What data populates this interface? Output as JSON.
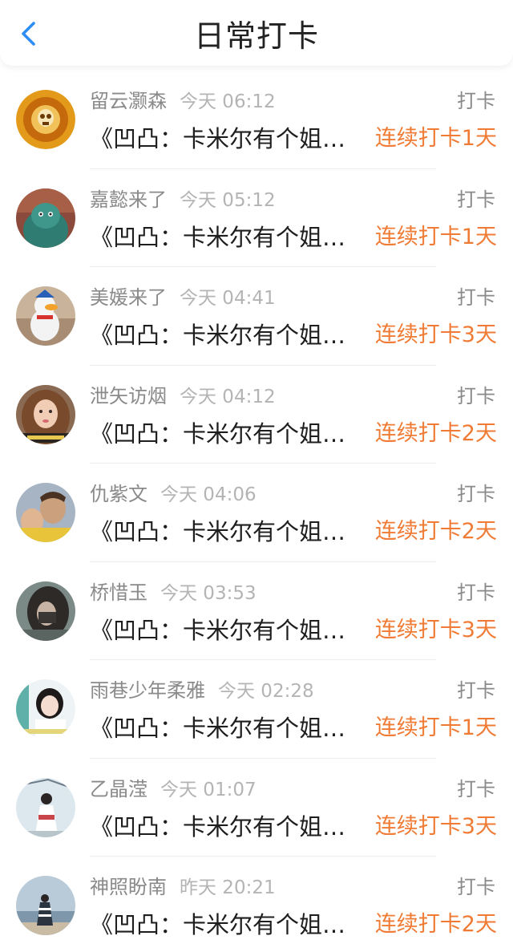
{
  "header": {
    "title": "日常打卡",
    "back_icon": "chevron-left-icon",
    "accent_color": "#2f8ef6"
  },
  "colors": {
    "streak": "#f07b34",
    "name": "#8a8a8a",
    "time": "#b4b4b4"
  },
  "entries": [
    {
      "name": "留云灏森",
      "time": "今天 06:12",
      "action": "打卡",
      "book": "《凹凸：卡米尔有个姐…",
      "streak": "连续打卡1天"
    },
    {
      "name": "嘉懿来了",
      "time": "今天 05:12",
      "action": "打卡",
      "book": "《凹凸：卡米尔有个姐…",
      "streak": "连续打卡1天"
    },
    {
      "name": "美媛来了",
      "time": "今天 04:41",
      "action": "打卡",
      "book": "《凹凸：卡米尔有个姐…",
      "streak": "连续打卡3天"
    },
    {
      "name": "泄矢访烟",
      "time": "今天 04:12",
      "action": "打卡",
      "book": "《凹凸：卡米尔有个姐…",
      "streak": "连续打卡2天"
    },
    {
      "name": "仇紫文",
      "time": "今天 04:06",
      "action": "打卡",
      "book": "《凹凸：卡米尔有个姐…",
      "streak": "连续打卡2天"
    },
    {
      "name": "桥惜玉",
      "time": "今天 03:53",
      "action": "打卡",
      "book": "《凹凸：卡米尔有个姐…",
      "streak": "连续打卡3天"
    },
    {
      "name": "雨巷少年柔雅",
      "time": "今天 02:28",
      "action": "打卡",
      "book": "《凹凸：卡米尔有个姐…",
      "streak": "连续打卡1天"
    },
    {
      "name": "乙晶滢",
      "time": "今天 01:07",
      "action": "打卡",
      "book": "《凹凸：卡米尔有个姐…",
      "streak": "连续打卡3天"
    },
    {
      "name": "神照盼南",
      "time": "昨天 20:21",
      "action": "打卡",
      "book": "《凹凸：卡米尔有个姐…",
      "streak": "连续打卡2天"
    }
  ]
}
